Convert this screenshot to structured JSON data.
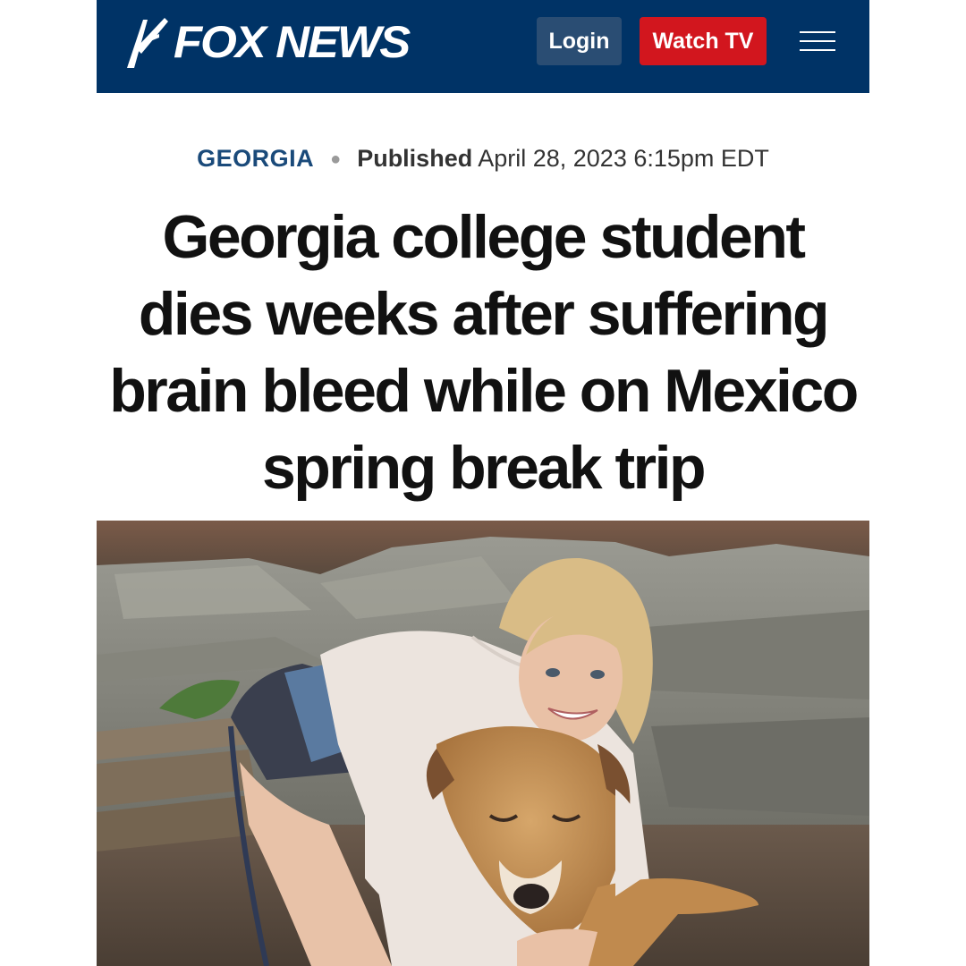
{
  "header": {
    "logo_text": "FOX NEWS",
    "login_label": "Login",
    "watch_label": "Watch TV",
    "brand_color": "#003366",
    "watch_color": "#d2161e"
  },
  "article": {
    "section": "GEORGIA",
    "published_label": "Published",
    "published_date": "April 28, 2023 6:15pm EDT",
    "headline": "Georgia college student dies weeks after suffering brain bleed while on Mexico spring break trip"
  }
}
